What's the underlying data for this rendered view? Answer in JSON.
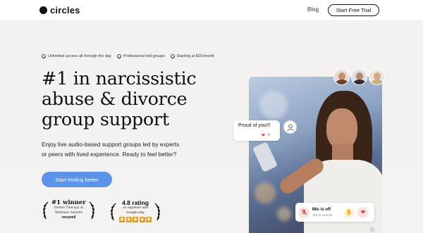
{
  "header": {
    "logo_text": "circles",
    "nav_blog": "Blog",
    "cta_label": "Start Free Trial"
  },
  "features": [
    {
      "label": "Unlimited access all through the day"
    },
    {
      "label": "Professional-led groups"
    },
    {
      "label": "Starting at $15/month"
    }
  ],
  "hero": {
    "headline_lines": [
      "#1 in narcissistic",
      "abuse & divorce",
      "group support"
    ],
    "description_lines": [
      "Enjoy live audio-based support groups led by experts",
      "or peers with lived experience. Ready to feel better?"
    ],
    "cta_label": "Start feeling better"
  },
  "awards": {
    "winner": {
      "title": "#1 winner",
      "subtitle_lines": [
        "Online Therapy &",
        "Wellness Awards"
      ],
      "brand": "verywell"
    },
    "rating": {
      "title": "4.8 rating",
      "subtitle_lines": [
        "on AppStore and",
        "Google play"
      ],
      "stars": 5
    }
  },
  "chat": {
    "message": "Proud of you!!!",
    "reaction_count": "5"
  },
  "controls": {
    "mic_title": "Mic is off",
    "mic_subtitle": "Tap to unmute"
  },
  "colors": {
    "accent": "#5a93e8",
    "heart": "#e0383e",
    "star": "#e99a1b"
  }
}
